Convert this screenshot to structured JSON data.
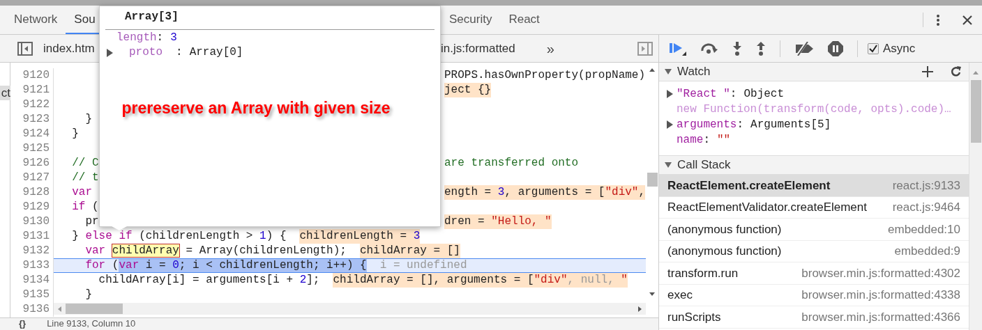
{
  "tabs": [
    {
      "label": "Network",
      "selected": false
    },
    {
      "label": "Sou",
      "selected": true
    },
    {
      "label": "Security",
      "selected": false
    },
    {
      "label": "React",
      "selected": false
    }
  ],
  "file_tabs": [
    {
      "label": "index.htm"
    },
    {
      "label": "in.js:formatted"
    }
  ],
  "more_tabs": "»",
  "navigator": {
    "item": "ct"
  },
  "editor": {
    "lines": [
      {
        "number": "9120",
        "current": false,
        "right": {
          "kind": "code",
          "segments": [
            {
              "text": "PROPS.hasOwnProperty(propName)",
              "kind": "plain"
            }
          ]
        }
      },
      {
        "number": "9121",
        "current": false,
        "right": {
          "kind": "value",
          "segments": [
            {
              "text": "ject {}",
              "kind": "plain"
            }
          ]
        }
      },
      {
        "number": "9122",
        "current": false
      },
      {
        "number": "9123",
        "current": false,
        "code": [
          {
            "text": "    }",
            "kind": "plain"
          }
        ]
      },
      {
        "number": "9124",
        "current": false,
        "code": [
          {
            "text": "  }",
            "kind": "plain"
          }
        ]
      },
      {
        "number": "9125",
        "current": false
      },
      {
        "number": "9126",
        "current": false,
        "code": [
          {
            "text": "  // C",
            "kind": "comment"
          }
        ],
        "right": {
          "kind": "code",
          "segments": [
            {
              "text": "are transferred onto",
              "kind": "comment"
            }
          ]
        }
      },
      {
        "number": "9127",
        "current": false,
        "code": [
          {
            "text": "  // t",
            "kind": "comment"
          }
        ]
      },
      {
        "number": "9128",
        "current": false,
        "code": [
          {
            "text": "  var",
            "kind": "keyword"
          }
        ],
        "right": {
          "kind": "value",
          "segments": [
            {
              "text": "ength = ",
              "kind": "plain"
            },
            {
              "text": "3",
              "kind": "number"
            },
            {
              "text": ", arguments = [",
              "kind": "plain"
            },
            {
              "text": "\"div\"",
              "kind": "string"
            },
            {
              "text": ",",
              "kind": "plain"
            }
          ]
        }
      },
      {
        "number": "9129",
        "current": false,
        "code": [
          {
            "text": "  if",
            "kind": "keyword"
          },
          {
            "text": " (",
            "kind": "plain"
          }
        ]
      },
      {
        "number": "9130",
        "current": false,
        "code": [
          {
            "text": "    pr",
            "kind": "plain"
          }
        ],
        "right": {
          "kind": "value",
          "segments": [
            {
              "text": "dren = ",
              "kind": "plain"
            },
            {
              "text": "\"Hello, \"",
              "kind": "string"
            }
          ]
        }
      },
      {
        "number": "9131",
        "current": false,
        "code": [
          {
            "text": "  }",
            "kind": "plain"
          },
          {
            "text": " else if",
            "kind": "keyword"
          },
          {
            "text": " (childrenLength > ",
            "kind": "plain"
          },
          {
            "text": "1",
            "kind": "number"
          },
          {
            "text": ") {",
            "kind": "plain"
          }
        ],
        "values": [
          {
            "text": "childrenLength = ",
            "kind": "plain"
          },
          {
            "text": "3",
            "kind": "number"
          }
        ]
      },
      {
        "number": "9132",
        "current": false,
        "code": [
          {
            "text": "    var ",
            "kind": "keyword"
          },
          {
            "text": "childArray",
            "kind": "token"
          },
          {
            "text": " = Array(childrenLength);",
            "kind": "plain"
          }
        ],
        "values": [
          {
            "text": "childArray = []",
            "kind": "plain"
          }
        ]
      },
      {
        "number": "9133",
        "current": true,
        "code": [
          {
            "text": "    for",
            "kind": "keyword"
          },
          {
            "text": " (",
            "kind": "plain"
          }
        ],
        "selection": [
          {
            "text": "var",
            "kind": "keyword"
          },
          {
            "text": " i = ",
            "kind": "plain"
          },
          {
            "text": "0",
            "kind": "number"
          },
          {
            "text": "; i < childrenLength; i++) {",
            "kind": "plain"
          }
        ],
        "values": [
          {
            "text": "i = undefined",
            "kind": "muted"
          }
        ]
      },
      {
        "number": "9134",
        "current": false,
        "code": [
          {
            "text": "      childArray[i] = arguments[i + ",
            "kind": "plain"
          },
          {
            "text": "2",
            "kind": "number"
          },
          {
            "text": "];",
            "kind": "plain"
          }
        ],
        "values": [
          {
            "text": "childArray = [], arguments = [",
            "kind": "plain"
          },
          {
            "text": "\"div\"",
            "kind": "string"
          },
          {
            "text": ", null, ",
            "kind": "muted"
          },
          {
            "text": "\"",
            "kind": "string"
          }
        ]
      },
      {
        "number": "9135",
        "current": false,
        "code": [
          {
            "text": "    }",
            "kind": "plain"
          }
        ]
      },
      {
        "number": "9136",
        "current": false
      }
    ]
  },
  "popover": {
    "title": "Array[3]",
    "properties": [
      {
        "key": "length",
        "separator": ":",
        "value": "3",
        "kind": "number",
        "expandable": false
      },
      {
        "key": "proto",
        "separator": ":",
        "value": "Array[0]",
        "kind": "object",
        "expandable": true
      }
    ],
    "annotation": "prereserve an Array with given size"
  },
  "debugger": {
    "async": {
      "label": "Async",
      "checked": true
    }
  },
  "watch": {
    "title": "Watch",
    "expanded": true,
    "items": [
      {
        "kind": "object",
        "key": "\"React \"",
        "separator": ":",
        "value": "Object"
      },
      {
        "kind": "note",
        "text": "new Function(transform(code, opts).code)…"
      },
      {
        "kind": "object",
        "key": "arguments",
        "separator": ":",
        "value": "Arguments[5]"
      },
      {
        "kind": "property",
        "key": "name",
        "separator": ":",
        "value": "\"\""
      }
    ]
  },
  "call_stack": {
    "title": "Call Stack",
    "expanded": true,
    "frames": [
      {
        "function": "ReactElement.createElement",
        "location": "react.js:9133",
        "selected": true
      },
      {
        "function": "ReactElementValidator.createElement",
        "location": "react.js:9464",
        "selected": false
      },
      {
        "function": "(anonymous function)",
        "location": "embedded:10",
        "selected": false
      },
      {
        "function": "(anonymous function)",
        "location": "embedded:9",
        "selected": false
      },
      {
        "function": "transform.run",
        "location": "browser.min.js:formatted:4302",
        "selected": false
      },
      {
        "function": "exec",
        "location": "browser.min.js:formatted:4338",
        "selected": false
      },
      {
        "function": "runScripts",
        "location": "browser.min.js:formatted:4366",
        "selected": false
      }
    ]
  },
  "status_bar": {
    "format_button": "{}",
    "position": "Line 9133, Column 10"
  }
}
